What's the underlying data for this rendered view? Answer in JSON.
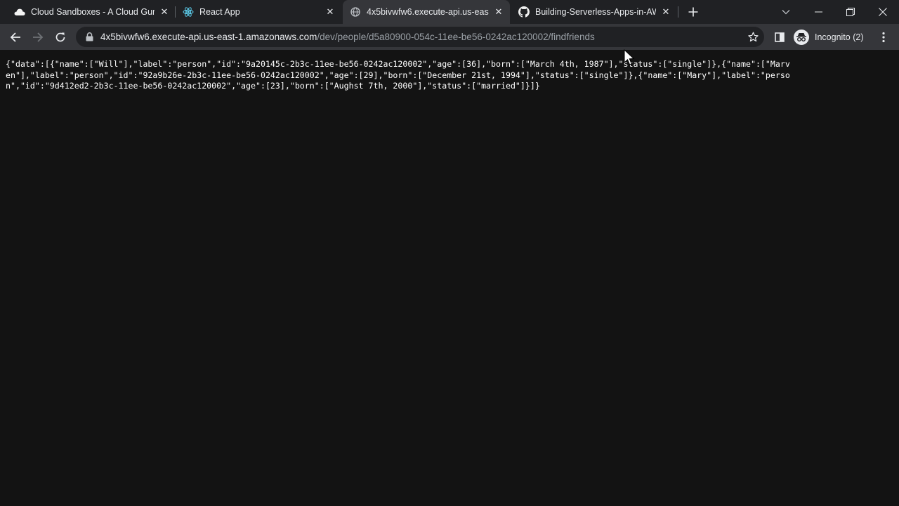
{
  "tabs": [
    {
      "title": "Cloud Sandboxes - A Cloud Guru",
      "icon": "cloud-icon",
      "active": false
    },
    {
      "title": "React App",
      "icon": "react-icon",
      "active": false
    },
    {
      "title": "4x5bivwfw6.execute-api.us-east-",
      "icon": "globe-icon",
      "active": true
    },
    {
      "title": "Building-Serverless-Apps-in-AWS",
      "icon": "github-icon",
      "active": false
    }
  ],
  "omnibox": {
    "host": "4x5bivwfw6.execute-api.us-east-1.amazonaws.com",
    "path": "/dev/people/d5a80900-054c-11ee-be56-0242ac120002/findfriends"
  },
  "profile": {
    "label": "Incognito (2)"
  },
  "page": {
    "json_text": "{\"data\":[{\"name\":[\"Will\"],\"label\":\"person\",\"id\":\"9a20145c-2b3c-11ee-be56-0242ac120002\",\"age\":[36],\"born\":[\"March 4th, 1987\"],\"status\":[\"single\"]},{\"name\":[\"Marven\"],\"label\":\"person\",\"id\":\"92a9b26e-2b3c-11ee-be56-0242ac120002\",\"age\":[29],\"born\":[\"December 21st, 1994\"],\"status\":[\"single\"]},{\"name\":[\"Mary\"],\"label\":\"person\",\"id\":\"9d412ed2-2b3c-11ee-be56-0242ac120002\",\"age\":[23],\"born\":[\"Aughst 7th, 2000\"],\"status\":[\"married\"]}]}"
  },
  "colors": {
    "tabstrip": "#202124",
    "toolbar": "#35363a",
    "omnibox": "#202124",
    "page_background": "#131313"
  }
}
